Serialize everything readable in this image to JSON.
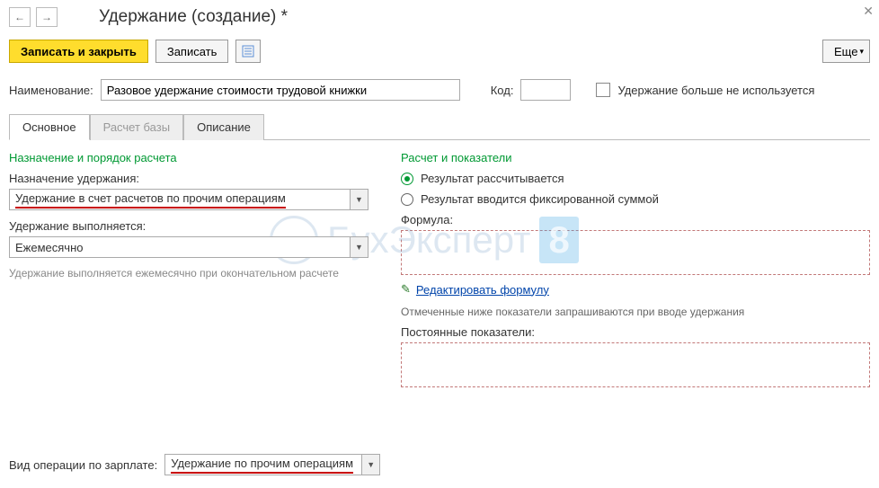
{
  "header": {
    "title": "Удержание (создание) *"
  },
  "toolbar": {
    "save_close": "Записать и закрыть",
    "save": "Записать",
    "more": "Еще"
  },
  "fields": {
    "name_label": "Наименование:",
    "name_value": "Разовое удержание стоимости трудовой книжки",
    "code_label": "Код:",
    "code_value": "",
    "not_used_label": "Удержание больше не используется"
  },
  "tabs": {
    "main": "Основное",
    "base": "Расчет базы",
    "desc": "Описание"
  },
  "left": {
    "group_title": "Назначение и порядок расчета",
    "purpose_label": "Назначение удержания:",
    "purpose_value": "Удержание в счет расчетов по прочим операциям",
    "perform_label": "Удержание выполняется:",
    "perform_value": "Ежемесячно",
    "perform_note": "Удержание выполняется ежемесячно при окончательном расчете"
  },
  "right": {
    "group_title": "Расчет и показатели",
    "radio_calc": "Результат рассчитывается",
    "radio_fixed": "Результат вводится фиксированной суммой",
    "formula_label": "Формула:",
    "edit_formula": "Редактировать формулу",
    "indicators_note": "Отмеченные ниже показатели запрашиваются при вводе удержания",
    "constant_label": "Постоянные показатели:"
  },
  "bottom": {
    "op_type_label": "Вид операции по зарплате:",
    "op_type_value": "Удержание по прочим операциям"
  },
  "watermark": {
    "text": "БухЭксперт",
    "badge": "8"
  }
}
